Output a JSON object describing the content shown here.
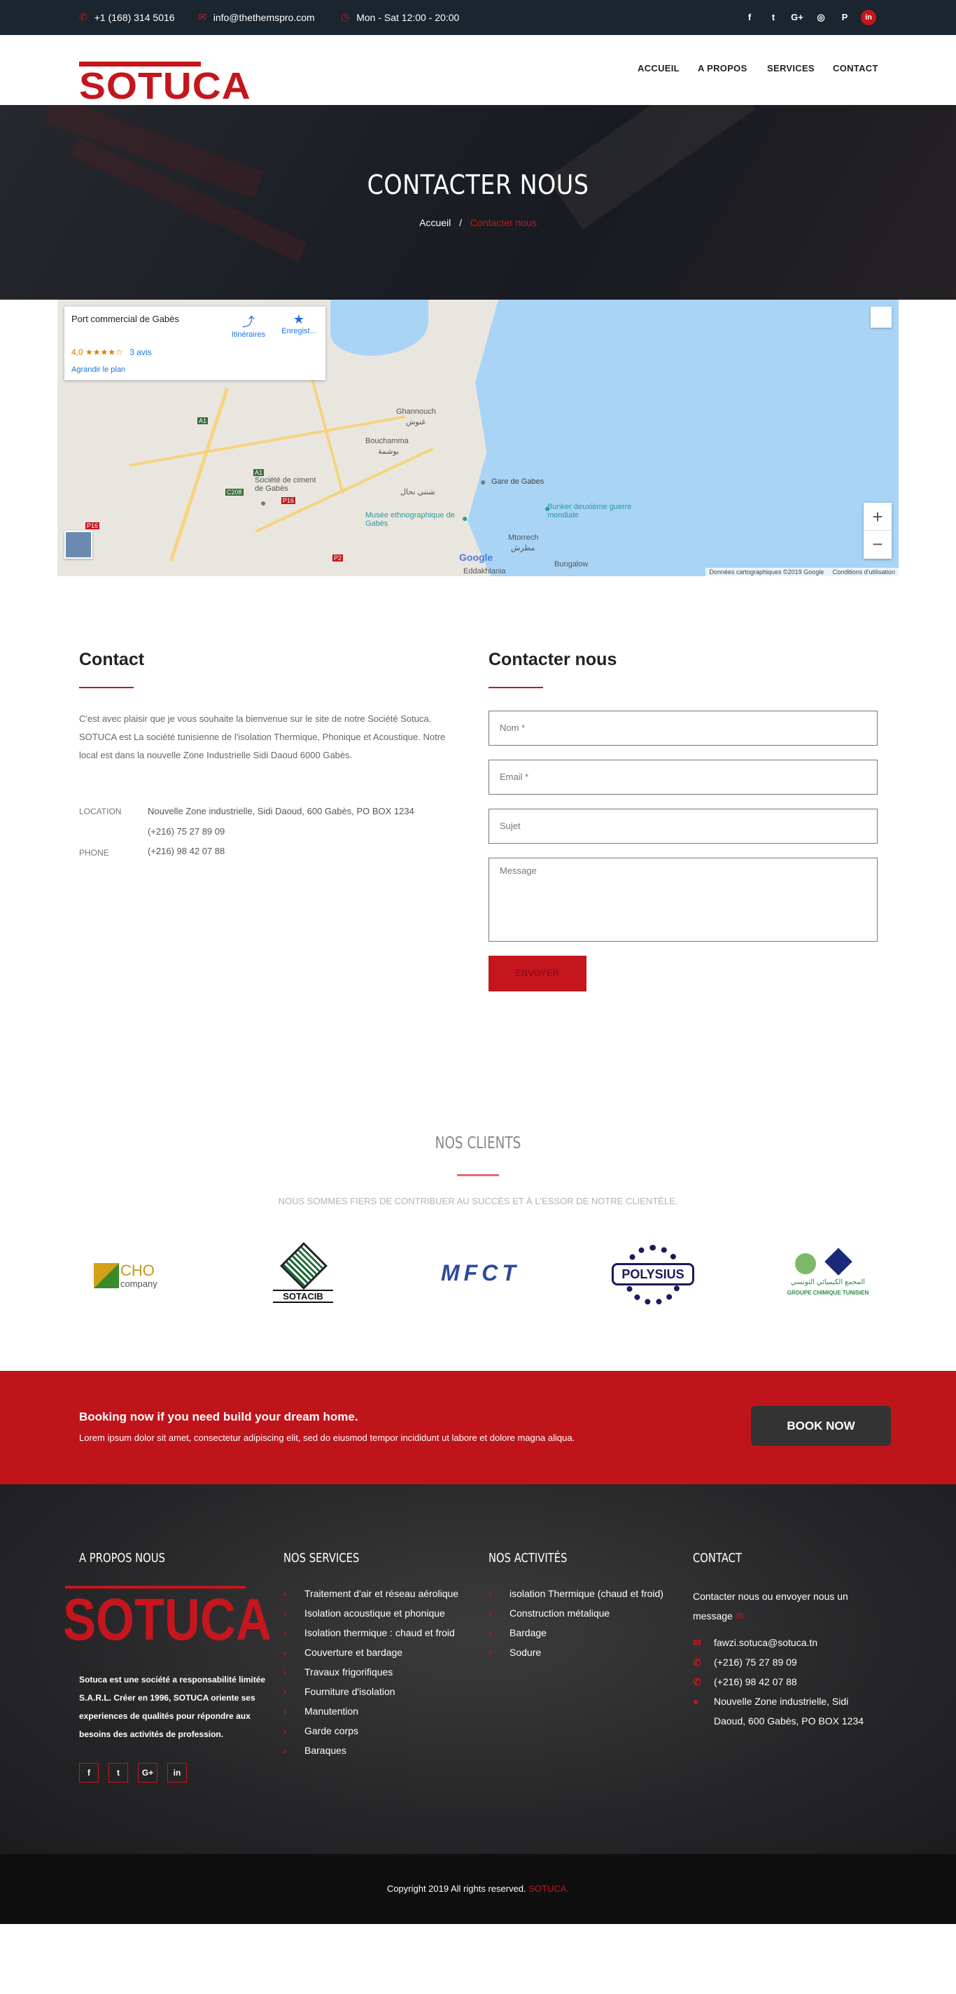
{
  "topbar": {
    "phone": "+1 (168) 314 5016",
    "email": "info@thethemspro.com",
    "hours": "Mon - Sat 12:00 - 20:00",
    "social": [
      "f",
      "t",
      "G+",
      "◎",
      "P",
      "in"
    ]
  },
  "header": {
    "logo": "SOTUCA",
    "nav": [
      "ACCUEIL",
      "A PROPOS",
      "SERVICES",
      "CONTACT"
    ]
  },
  "hero": {
    "title": "CONTACTER NOUS",
    "breadcrumb_home": "Accueil",
    "breadcrumb_sep": "/",
    "breadcrumb_current": "Contacter nous"
  },
  "map": {
    "place_title": "Port commercial de Gabès",
    "rating": "4,0",
    "stars": "★★★★☆",
    "reviews": "3 avis",
    "enlarge": "Agrandir le plan",
    "directions": "Itinéraires",
    "save": "Enregist...",
    "labels": {
      "ghannouch": "Ghannouch",
      "ghannouch_ar": "غنوش",
      "bouchamma": "Bouchamma",
      "bouchamma_ar": "بوشمة",
      "cement": "Société de ciment de Gabès",
      "chenini": "شنني نحال",
      "museum": "Musée ethnographique de Gabès",
      "gare": "Gare de Gabes",
      "bunker": "Bunker deuxième guerre mondiale",
      "mtorrech": "Mtorrech",
      "mtorrech_ar": "مطرش",
      "bungalow": "Bungalow",
      "eddakhlania": "Eddakhlania",
      "road_a1": "A1",
      "road_p16": "P16",
      "road_c208": "C208",
      "road_p2": "P2"
    },
    "google": "Google",
    "zoom_in": "+",
    "zoom_out": "−",
    "attribution": "Données cartographiques ©2019 Google",
    "terms": "Conditions d'utilisation"
  },
  "contact": {
    "title": "Contact",
    "text": "C'est avec plaisir que je vous souhaite la bienvenue sur le site de notre Société Sotuca. SOTUCA est La société tunisienne de l'isolation Thermique, Phonique et Acoustique. Notre local est dans la nouvelle Zone Industrielle Sidi Daoud 6000 Gabès.",
    "location_label": "LOCATION",
    "location_value": "Nouvelle Zone industrielle, Sidi Daoud, 600 Gabès, PO BOX 1234",
    "phone1": "(+216) 75 27 89 09",
    "phone_label": "PHONE",
    "phone2": "(+216) 98 42 07 88"
  },
  "form": {
    "title": "Contacter nous",
    "name_placeholder": "Nom *",
    "email_placeholder": "Email *",
    "subject_placeholder": "Sujet",
    "message_placeholder": "Message",
    "submit": "ENVOYER"
  },
  "clients": {
    "title": "NOS CLIENTS",
    "subtitle": "NOUS SOMMES FIERS DE CONTRIBUER AU SUCCÈS ET À L'ESSOR DE NOTRE CLIENTÈLE.",
    "logos": {
      "cho_main": "CHO",
      "cho_sub": "company",
      "sotacib": "SOTACIB",
      "mfct": "MFCT",
      "polysius": "POLYSIUS",
      "gct_ar": "المجمع الكيميائي التونسي",
      "gct_fr": "GROUPE CHIMIQUE TUNISIEN"
    }
  },
  "booking": {
    "title": "Booking now if you need build your dream home.",
    "text": "Lorem ipsum dolor sit amet, consectetur adipiscing elit, sed do eiusmod tempor incididunt ut labore et dolore magna aliqua.",
    "button": "BOOK NOW"
  },
  "footer": {
    "about_title": "A PROPOS NOUS",
    "about_logo": "SOTUCA",
    "about_text": "Sotuca est une société a responsabilité limitée S.A.R.L. Créer en 1996, SOTUCA oriente ses experiences de qualités pour répondre aux besoins des activités de profession.",
    "social": [
      "f",
      "t",
      "G+",
      "in"
    ],
    "services_title": "NOS SERVICES",
    "services": [
      "Traitement d'air et réseau aérolique",
      "Isolation acoustique et phonique",
      "Isolation thermique : chaud et froid",
      "Couverture et bardage",
      "Travaux frigorifiques",
      "Fourniture d'isolation",
      "Manutention",
      "Garde corps",
      "Baraques"
    ],
    "activities_title": "NOS ACTIVITÉS",
    "activities": [
      "isolation Thermique (chaud et froid)",
      "Construction métalique",
      "Bardage",
      "Sodure"
    ],
    "contact_title": "CONTACT",
    "contact_intro": "Contacter nous ou envoyer nous un message",
    "contact_email": "fawzi.sotuca@sotuca.tn",
    "contact_phone1": "(+216) 75 27 89 09",
    "contact_phone2": "(+216) 98 42 07 88",
    "contact_address": "Nouvelle Zone industrielle, Sidi Daoud, 600 Gabès, PO BOX 1234"
  },
  "copyright": {
    "text": "Copyright 2019 All rights reserved.",
    "brand": "SOTUCA."
  },
  "colors": {
    "accent": "#c5161d",
    "topbar": "#1b2530",
    "footer_bottom": "#0f0f10"
  }
}
